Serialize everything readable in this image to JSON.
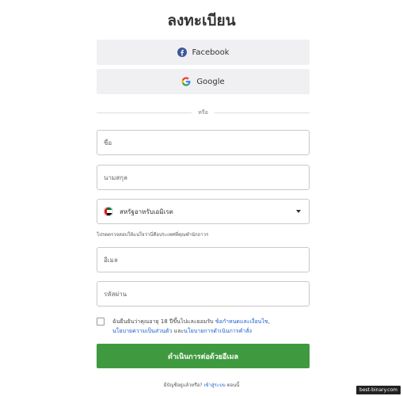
{
  "page": {
    "title": "ลงทะเบียน"
  },
  "social": {
    "facebook_label": "Facebook",
    "google_label": "Google"
  },
  "divider_text": "หรือ",
  "fields": {
    "first_name_placeholder": "ชื่อ",
    "last_name_placeholder": "นามสกุล",
    "country_value": "สหรัฐอาหรับเอมิเรต",
    "country_hint": "โปรดตรวจสอบให้แน่ใจว่านี่คือประเทศที่คุณพำนักถาวร",
    "email_placeholder": "อีเมล",
    "password_placeholder": "รหัสผ่าน"
  },
  "consent": {
    "prefix": "ฉันยืนยันว่าคุณอายุ 18 ปีขึ้นไปและยอมรับ ",
    "terms_link": "ข้อกำหนดและเงื่อนไข",
    "comma": ",",
    "privacy_link": "นโยบายความเป็นส่วนตัว",
    "and": " และ",
    "execution_link": "นโยบายการดำเนินการคำสั่ง",
    "checked": false
  },
  "submit_label": "ดำเนินการต่อด้วยอีเมล",
  "login": {
    "prompt": "มีบัญชีอยู่แล้วหรือ? ",
    "link": "เข้าสู่ระบบ",
    "suffix": " ตอนนี้"
  },
  "watermark": "best-binary.com",
  "icons": {
    "facebook": "facebook-icon",
    "google": "google-icon",
    "country_flag": "uae-flag-icon",
    "dropdown": "chevron-down-icon"
  },
  "colors": {
    "facebook_blue": "#3b5998",
    "submit_green": "#3f9a3f",
    "link_blue": "#1a5ecb"
  }
}
